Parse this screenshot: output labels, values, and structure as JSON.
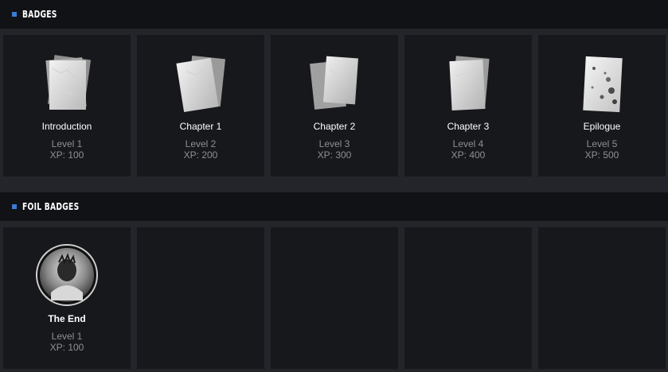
{
  "badges_section": {
    "title": "BADGES",
    "items": [
      {
        "name": "Introduction",
        "level": "Level 1",
        "xp": "XP: 100",
        "icon": "paper-stack-icon"
      },
      {
        "name": "Chapter 1",
        "level": "Level 2",
        "xp": "XP: 200",
        "icon": "paper-stack-icon"
      },
      {
        "name": "Chapter 2",
        "level": "Level 3",
        "xp": "XP: 300",
        "icon": "paper-stack-icon"
      },
      {
        "name": "Chapter 3",
        "level": "Level 4",
        "xp": "XP: 400",
        "icon": "paper-stack-icon"
      },
      {
        "name": "Epilogue",
        "level": "Level 5",
        "xp": "XP: 500",
        "icon": "stained-paper-icon"
      }
    ]
  },
  "foil_section": {
    "title": "FOIL BADGES",
    "items": [
      {
        "name": "The End",
        "level": "Level 1",
        "xp": "XP: 100",
        "icon": "portrait-medallion-icon"
      }
    ]
  },
  "colors": {
    "accent": "#3a7bd5",
    "background": "#23252a",
    "card": "#17181c",
    "header": "#111215"
  }
}
